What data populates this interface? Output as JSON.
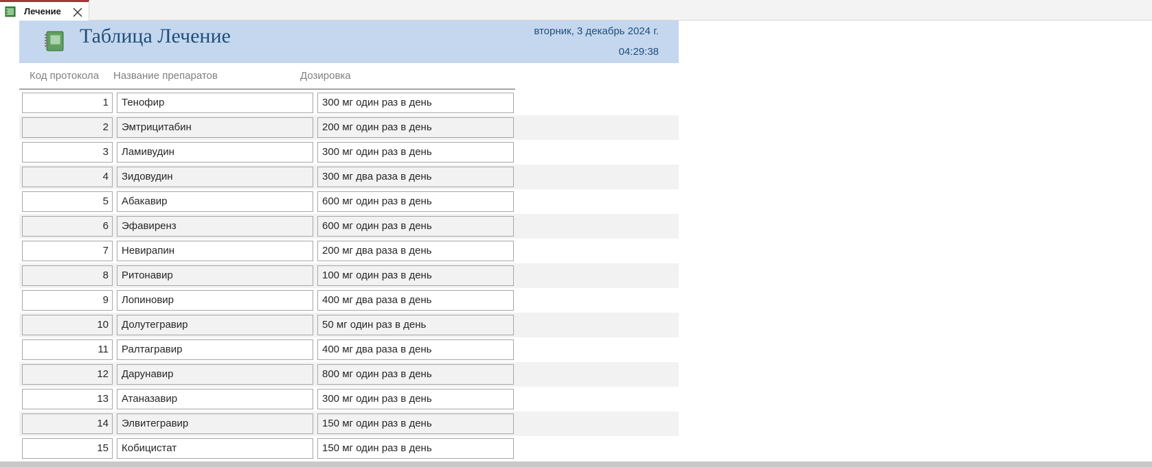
{
  "tab": {
    "label": "Лечение"
  },
  "report": {
    "title": "Таблица Лечение",
    "date": "вторник, 3 декабрь 2024 г.",
    "time": "04:29:38",
    "columns": [
      "Код протокола",
      "Название препаратов",
      "Дозировка"
    ]
  },
  "rows": [
    {
      "id": "1",
      "name": "Тенофир",
      "dose": "300 мг один раз в день"
    },
    {
      "id": "2",
      "name": "Эмтрицитабин",
      "dose": "200 мг один раз в день"
    },
    {
      "id": "3",
      "name": "Ламивудин",
      "dose": "300 мг один раз в день"
    },
    {
      "id": "4",
      "name": "Зидовудин",
      "dose": "300 мг два раза в день"
    },
    {
      "id": "5",
      "name": "Абакавир",
      "dose": "600 мг один раз в день"
    },
    {
      "id": "6",
      "name": "Эфавиренз",
      "dose": "600 мг один раз в день"
    },
    {
      "id": "7",
      "name": "Невирапин",
      "dose": "200 мг два раза в день"
    },
    {
      "id": "8",
      "name": "Ритонавир",
      "dose": "100 мг один раз в день"
    },
    {
      "id": "9",
      "name": "Лопиновир",
      "dose": "400 мг два раза в день"
    },
    {
      "id": "10",
      "name": "Долутегравир",
      "dose": "50 мг один раз в день"
    },
    {
      "id": "11",
      "name": "Ралтагравир",
      "dose": "400 мг два раза в день"
    },
    {
      "id": "12",
      "name": "Дарунавир",
      "dose": "800 мг один раз в день"
    },
    {
      "id": "13",
      "name": "Атаназавир",
      "dose": "300 мг один раз в день"
    },
    {
      "id": "14",
      "name": "Элвитегравир",
      "dose": "150 мг один раз в день"
    },
    {
      "id": "15",
      "name": "Кобицистат",
      "dose": "150 мг один раз в день"
    }
  ],
  "icons": {
    "tab": "report-icon",
    "close": "close-icon",
    "header": "notebook-icon"
  },
  "colors": {
    "header_bg": "#c5d7ef",
    "title": "#1f4e79",
    "tab_accent": "#a4373a"
  }
}
